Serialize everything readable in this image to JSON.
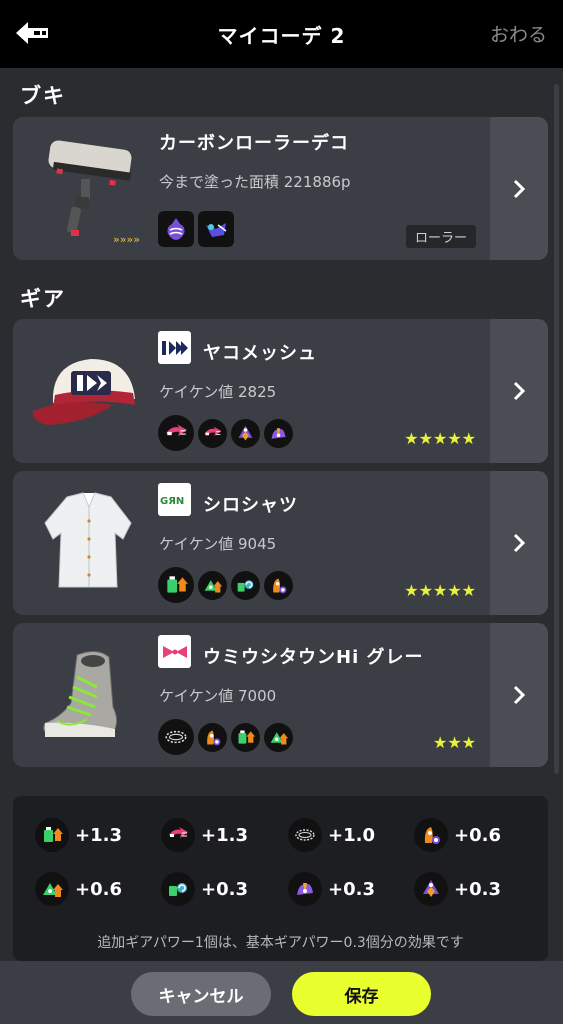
{
  "header": {
    "title": "マイコーデ 2",
    "finish_label": "おわる"
  },
  "sections": {
    "weapon_label": "ブキ",
    "gear_label": "ギア"
  },
  "weapon": {
    "name": "カーボンローラーデコ",
    "stat": "今まで塗った面積 221886p",
    "class_label": "ローラー",
    "sub_icon": "splash-wall-icon",
    "special_icon": "ink-vac-icon"
  },
  "gear": [
    {
      "name": "ヤコメッシュ",
      "exp_label": "ケイケン値 2825",
      "brand_icon": "zekko-brand-icon",
      "stars": "★★★★★",
      "main_ability": "quick-respawn-icon",
      "sub_abilities": [
        "quick-respawn-icon",
        "sub-resistance-up-icon",
        "special-saver-icon"
      ]
    },
    {
      "name": "シロシャツ",
      "exp_label": "ケイケン値 9045",
      "brand_icon": "squidforce-brand-icon",
      "stars": "★★★★★",
      "main_ability": "ink-saver-main-icon",
      "sub_abilities": [
        "run-speed-up-icon",
        "ink-recovery-up-icon",
        "quick-super-jump-icon"
      ]
    },
    {
      "name": "ウミウシタウンHi グレー",
      "exp_label": "ケイケン値 7000",
      "brand_icon": "tentatek-brand-icon",
      "stars": "★★★",
      "main_ability": "stealth-jump-icon",
      "sub_abilities": [
        "quick-super-jump-icon",
        "ink-saver-main-icon",
        "run-speed-up-icon"
      ]
    }
  ],
  "summary": {
    "items": [
      {
        "icon": "ink-saver-main-icon",
        "value": "+1.3"
      },
      {
        "icon": "quick-respawn-icon",
        "value": "+1.3"
      },
      {
        "icon": "stealth-jump-icon",
        "value": "+1.0"
      },
      {
        "icon": "quick-super-jump-icon",
        "value": "+0.6"
      },
      {
        "icon": "run-speed-up-icon",
        "value": "+0.6"
      },
      {
        "icon": "ink-recovery-up-icon",
        "value": "+0.3"
      },
      {
        "icon": "special-saver-icon",
        "value": "+0.3"
      },
      {
        "icon": "sub-resistance-up-icon",
        "value": "+0.3"
      }
    ],
    "note": "追加ギアパワー1個は、基本ギアパワー0.3個分の効果です"
  },
  "footer": {
    "cancel_label": "キャンセル",
    "save_label": "保存"
  },
  "colors": {
    "accent": "#eaff2e",
    "background": "#2b2c30",
    "card": "#3c3e45",
    "star": "#e8f23a"
  }
}
